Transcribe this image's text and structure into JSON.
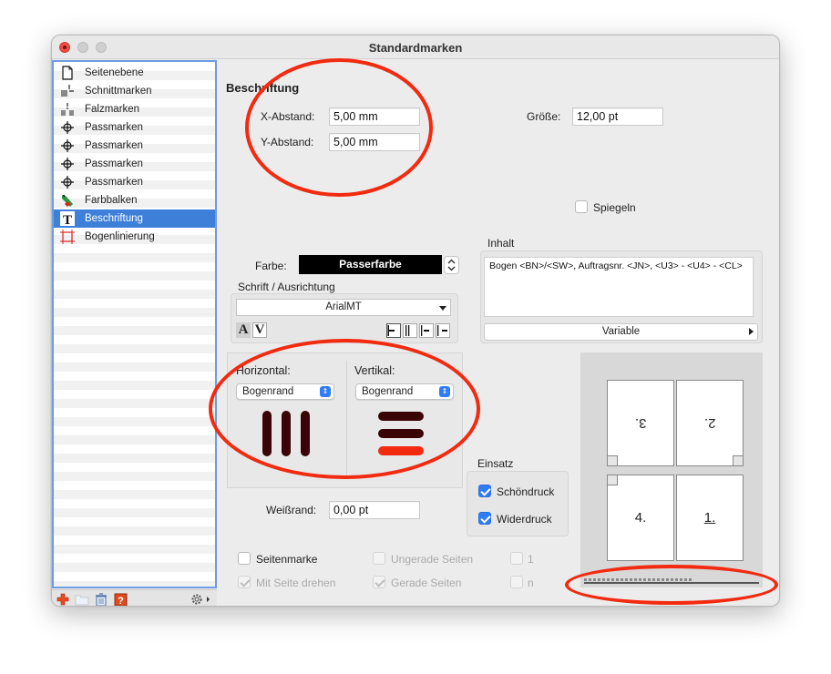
{
  "window": {
    "title": "Standardmarken"
  },
  "sidebar": {
    "items": [
      {
        "label": "Seitenebene",
        "icon": "page-icon"
      },
      {
        "label": "Schnittmarken",
        "icon": "cut-marks-icon"
      },
      {
        "label": "Falzmarken",
        "icon": "fold-marks-icon"
      },
      {
        "label": "Passmarken",
        "icon": "registration-mark-icon"
      },
      {
        "label": "Passmarken",
        "icon": "registration-mark-icon"
      },
      {
        "label": "Passmarken",
        "icon": "registration-mark-icon"
      },
      {
        "label": "Passmarken",
        "icon": "registration-mark-icon"
      },
      {
        "label": "Farbbalken",
        "icon": "color-bar-icon"
      },
      {
        "label": "Beschriftung",
        "icon": "text-icon",
        "selected": true
      },
      {
        "label": "Bogenlinierung",
        "icon": "sheet-lines-icon"
      }
    ]
  },
  "section_title": "Beschriftung",
  "x_abstand": {
    "label": "X-Abstand:",
    "value": "5,00 mm"
  },
  "y_abstand": {
    "label": "Y-Abstand:",
    "value": "5,00 mm"
  },
  "groesse": {
    "label": "Größe:",
    "value": "12,00 pt"
  },
  "spiegeln": {
    "label": "Spiegeln",
    "checked": false
  },
  "farbe": {
    "label": "Farbe:",
    "value": "Passerfarbe"
  },
  "schrift": {
    "label": "Schrift / Ausrichtung",
    "font": "ArialMT"
  },
  "inhalt": {
    "label": "Inhalt",
    "text": "Bogen <BN>/<SW>, Auftragsnr. <JN>, <U3> - <U4> - <CL>",
    "variable_button": "Variable"
  },
  "horizontal": {
    "label": "Horizontal:",
    "value": "Bogenrand"
  },
  "vertikal": {
    "label": "Vertikal:",
    "value": "Bogenrand"
  },
  "einsatz": {
    "label": "Einsatz",
    "schoendruck": {
      "label": "Schöndruck",
      "checked": true
    },
    "widerdruck": {
      "label": "Widerdruck",
      "checked": true
    }
  },
  "weissrand": {
    "label": "Weißrand:",
    "value": "0,00 pt"
  },
  "options": {
    "seitenmarke": "Seitenmarke",
    "mit_seite_drehen": "Mit Seite drehen",
    "ungerade_seiten": "Ungerade Seiten",
    "gerade_seiten": "Gerade Seiten",
    "page_one": "1",
    "page_n": "n"
  },
  "preview": {
    "pages": [
      "3.",
      "2.",
      "4.",
      "1."
    ]
  },
  "colors": {
    "accent": "#3d7fd9",
    "annotation": "#f22a10",
    "mark_dark": "#3a0306",
    "mark_red": "#f22a10"
  }
}
